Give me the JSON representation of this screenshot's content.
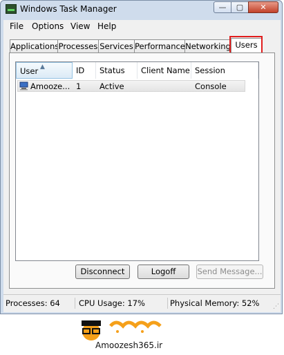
{
  "window": {
    "title": "Windows Task Manager"
  },
  "title_buttons": {
    "minimize": "—",
    "maximize": "▢",
    "close": "✕"
  },
  "menu": [
    "File",
    "Options",
    "View",
    "Help"
  ],
  "tabs": [
    "Applications",
    "Processes",
    "Services",
    "Performance",
    "Networking",
    "Users"
  ],
  "active_tab": "Users",
  "columns": [
    "User",
    "ID",
    "Status",
    "Client Name",
    "Session"
  ],
  "rows": [
    {
      "user": "Amooze...",
      "id": "1",
      "status": "Active",
      "client_name": "",
      "session": "Console"
    }
  ],
  "buttons": {
    "disconnect": "Disconnect",
    "logoff": "Logoff",
    "send_message": "Send Message..."
  },
  "status_bar": {
    "processes": "Processes: 64",
    "cpu": "CPU Usage: 17%",
    "memory": "Physical Memory: 52%"
  },
  "watermark": {
    "text": "Amoozesh365.ir"
  },
  "colors": {
    "highlight": "#e11c1c",
    "watermark_orange": "#f5a01a"
  },
  "icons": {
    "app": "task-manager-icon",
    "user": "user-monitor-icon",
    "sort": "sort-ascending-icon"
  }
}
